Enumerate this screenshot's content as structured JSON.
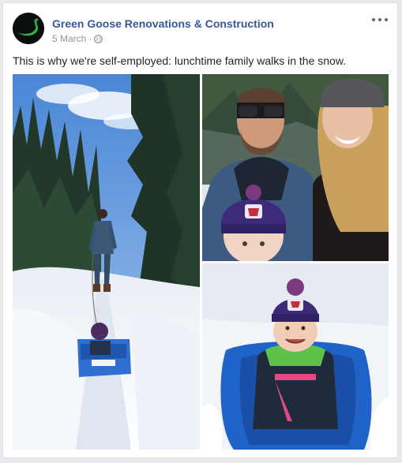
{
  "post": {
    "page_name": "Green Goose Renovations & Construction",
    "date": "5 March",
    "separator": "·",
    "privacy_icon": "globe-icon",
    "menu_icon": "more-options-icon",
    "caption": "This is why we're self-employed: lunchtime family walks in the snow."
  },
  "photos": [
    {
      "id": "photo-walk",
      "subject": "person-pulling-sled-on-snowy-trail"
    },
    {
      "id": "photo-selfie",
      "subject": "family-selfie"
    },
    {
      "id": "photo-sled",
      "subject": "baby-in-blue-sled"
    }
  ],
  "colors": {
    "link": "#365899",
    "meta": "#90949c",
    "text": "#1d2129",
    "page_bg": "#e9ebee",
    "logo_green": "#2fae4e"
  }
}
